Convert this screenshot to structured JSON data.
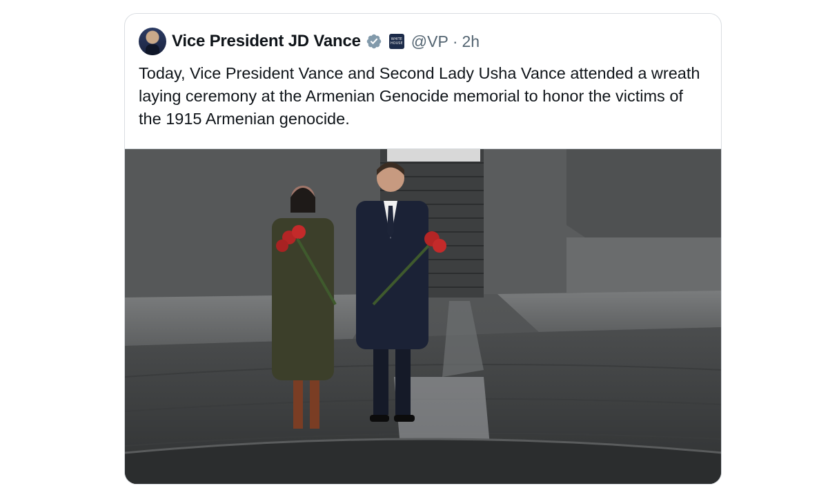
{
  "tweet": {
    "author": {
      "display_name": "Vice President JD Vance",
      "handle": "@VP",
      "separator": "·",
      "time": "2h",
      "verified_icon": "verified-badge-icon",
      "affiliation_icon": "government-badge-icon",
      "affiliation_text": "WHITE HOUSE"
    },
    "text": "Today, Vice President Vance and Second Lady Usha Vance attended a wreath laying ceremony at the Armenian Genocide memorial to honor the victims of the 1915 Armenian genocide.",
    "media": {
      "type": "photo"
    }
  },
  "colors": {
    "verified": "#829aab",
    "text_primary": "#0f1419",
    "text_secondary": "#536471",
    "border": "#d9dde1"
  }
}
